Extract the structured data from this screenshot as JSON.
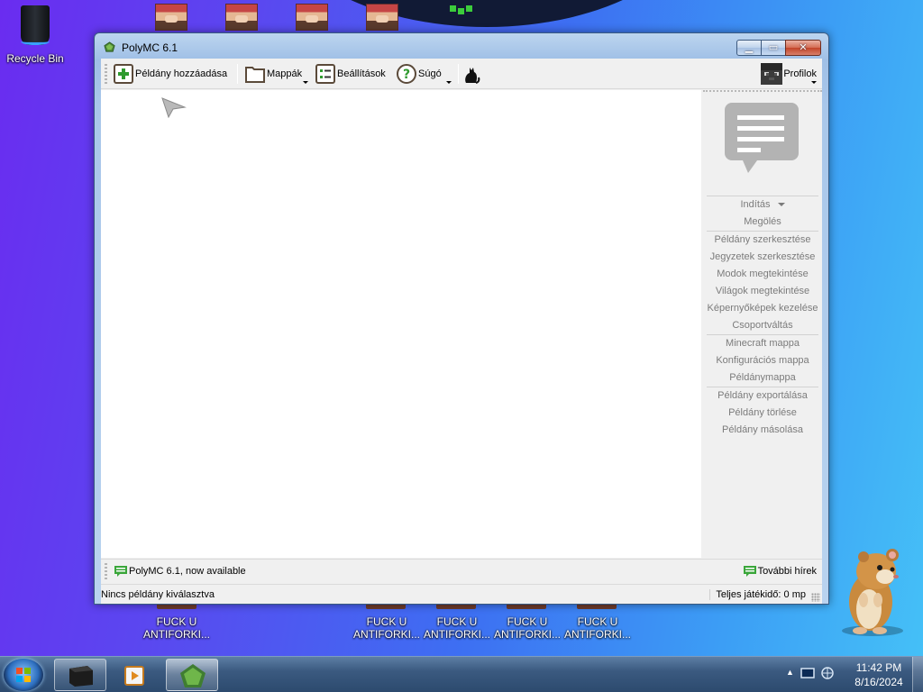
{
  "desktop": {
    "recycle_bin": "Recycle Bin",
    "shortcut_line1": "FUCK U",
    "shortcut_line2": "ANTIFORKI...",
    "shortcuts": [
      {
        "line1": "FUCK U",
        "line2": "ANTIFORKI..."
      },
      {
        "line1": "FUCK U",
        "line2": "ANTIFORKI..."
      },
      {
        "line1": "FUCK U",
        "line2": "ANTIFORKI..."
      },
      {
        "line1": "FUCK U",
        "line2": "ANTIFORKI..."
      },
      {
        "line1": "FUCK U",
        "line2": "ANTIFORKI..."
      }
    ]
  },
  "window": {
    "title": "PolyMC 6.1"
  },
  "toolbar": {
    "add_instance": "Példány hozzáadása",
    "folders": "Mappák",
    "settings": "Beállítások",
    "help": "Súgó",
    "profiles": "Profilok"
  },
  "sidebar": {
    "groups": [
      [
        "Indítás",
        "Megölés"
      ],
      [
        "Példány szerkesztése",
        "Jegyzetek szerkesztése",
        "Modok megtekintése",
        "Világok megtekintése",
        "Képernyőképek kezelése",
        "Csoportváltás"
      ],
      [
        "Minecraft mappa",
        "Konfigurációs mappa",
        "Példánymappa"
      ],
      [
        "Példány exportálása",
        "Példány törlése",
        "Példány másolása"
      ]
    ]
  },
  "news": {
    "headline": "PolyMC 6.1, now available",
    "more_news": "További hírek"
  },
  "status": {
    "selection": "Nincs példány kiválasztva",
    "playtime": "Teljes játékidő: 0 mp"
  },
  "taskbar": {
    "time": "11:42 PM",
    "date": "8/16/2024"
  },
  "colors": {
    "accent_green": "#3aa63a",
    "window_frame": "#a9c7ea",
    "sidebar_text": "#7b7b7b"
  },
  "icons": [
    "add-instance-icon",
    "folder-icon",
    "settings-icon",
    "help-icon",
    "cat-icon",
    "steve-avatar-icon",
    "news-bubble-icon",
    "chat-icon"
  ]
}
